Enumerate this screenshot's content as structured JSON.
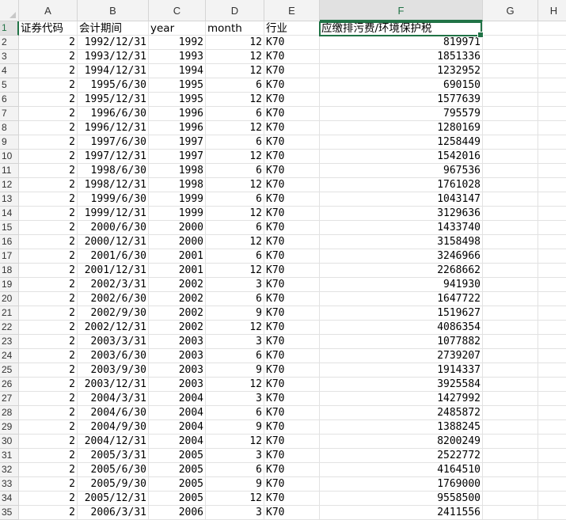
{
  "columns": [
    "A",
    "B",
    "C",
    "D",
    "E",
    "F",
    "G",
    "H"
  ],
  "selected_column": "F",
  "selected_row": "1",
  "header_row": {
    "row_label": "1",
    "cells": [
      "证券代码",
      "会计期间",
      "year",
      "month",
      "行业",
      "应缴排污费/环境保护税",
      "",
      ""
    ]
  },
  "rows": [
    {
      "n": "2",
      "a": "2",
      "b": "1992/12/31",
      "c": "1992",
      "d": "12",
      "e": "K70",
      "f": "819971"
    },
    {
      "n": "3",
      "a": "2",
      "b": "1993/12/31",
      "c": "1993",
      "d": "12",
      "e": "K70",
      "f": "1851336"
    },
    {
      "n": "4",
      "a": "2",
      "b": "1994/12/31",
      "c": "1994",
      "d": "12",
      "e": "K70",
      "f": "1232952"
    },
    {
      "n": "5",
      "a": "2",
      "b": "1995/6/30",
      "c": "1995",
      "d": "6",
      "e": "K70",
      "f": "690150"
    },
    {
      "n": "6",
      "a": "2",
      "b": "1995/12/31",
      "c": "1995",
      "d": "12",
      "e": "K70",
      "f": "1577639"
    },
    {
      "n": "7",
      "a": "2",
      "b": "1996/6/30",
      "c": "1996",
      "d": "6",
      "e": "K70",
      "f": "795579"
    },
    {
      "n": "8",
      "a": "2",
      "b": "1996/12/31",
      "c": "1996",
      "d": "12",
      "e": "K70",
      "f": "1280169"
    },
    {
      "n": "9",
      "a": "2",
      "b": "1997/6/30",
      "c": "1997",
      "d": "6",
      "e": "K70",
      "f": "1258449"
    },
    {
      "n": "10",
      "a": "2",
      "b": "1997/12/31",
      "c": "1997",
      "d": "12",
      "e": "K70",
      "f": "1542016"
    },
    {
      "n": "11",
      "a": "2",
      "b": "1998/6/30",
      "c": "1998",
      "d": "6",
      "e": "K70",
      "f": "967536"
    },
    {
      "n": "12",
      "a": "2",
      "b": "1998/12/31",
      "c": "1998",
      "d": "12",
      "e": "K70",
      "f": "1761028"
    },
    {
      "n": "13",
      "a": "2",
      "b": "1999/6/30",
      "c": "1999",
      "d": "6",
      "e": "K70",
      "f": "1043147"
    },
    {
      "n": "14",
      "a": "2",
      "b": "1999/12/31",
      "c": "1999",
      "d": "12",
      "e": "K70",
      "f": "3129636"
    },
    {
      "n": "15",
      "a": "2",
      "b": "2000/6/30",
      "c": "2000",
      "d": "6",
      "e": "K70",
      "f": "1433740"
    },
    {
      "n": "16",
      "a": "2",
      "b": "2000/12/31",
      "c": "2000",
      "d": "12",
      "e": "K70",
      "f": "3158498"
    },
    {
      "n": "17",
      "a": "2",
      "b": "2001/6/30",
      "c": "2001",
      "d": "6",
      "e": "K70",
      "f": "3246966"
    },
    {
      "n": "18",
      "a": "2",
      "b": "2001/12/31",
      "c": "2001",
      "d": "12",
      "e": "K70",
      "f": "2268662"
    },
    {
      "n": "19",
      "a": "2",
      "b": "2002/3/31",
      "c": "2002",
      "d": "3",
      "e": "K70",
      "f": "941930"
    },
    {
      "n": "20",
      "a": "2",
      "b": "2002/6/30",
      "c": "2002",
      "d": "6",
      "e": "K70",
      "f": "1647722"
    },
    {
      "n": "21",
      "a": "2",
      "b": "2002/9/30",
      "c": "2002",
      "d": "9",
      "e": "K70",
      "f": "1519627"
    },
    {
      "n": "22",
      "a": "2",
      "b": "2002/12/31",
      "c": "2002",
      "d": "12",
      "e": "K70",
      "f": "4086354"
    },
    {
      "n": "23",
      "a": "2",
      "b": "2003/3/31",
      "c": "2003",
      "d": "3",
      "e": "K70",
      "f": "1077882"
    },
    {
      "n": "24",
      "a": "2",
      "b": "2003/6/30",
      "c": "2003",
      "d": "6",
      "e": "K70",
      "f": "2739207"
    },
    {
      "n": "25",
      "a": "2",
      "b": "2003/9/30",
      "c": "2003",
      "d": "9",
      "e": "K70",
      "f": "1914337"
    },
    {
      "n": "26",
      "a": "2",
      "b": "2003/12/31",
      "c": "2003",
      "d": "12",
      "e": "K70",
      "f": "3925584"
    },
    {
      "n": "27",
      "a": "2",
      "b": "2004/3/31",
      "c": "2004",
      "d": "3",
      "e": "K70",
      "f": "1427992"
    },
    {
      "n": "28",
      "a": "2",
      "b": "2004/6/30",
      "c": "2004",
      "d": "6",
      "e": "K70",
      "f": "2485872"
    },
    {
      "n": "29",
      "a": "2",
      "b": "2004/9/30",
      "c": "2004",
      "d": "9",
      "e": "K70",
      "f": "1388245"
    },
    {
      "n": "30",
      "a": "2",
      "b": "2004/12/31",
      "c": "2004",
      "d": "12",
      "e": "K70",
      "f": "8200249"
    },
    {
      "n": "31",
      "a": "2",
      "b": "2005/3/31",
      "c": "2005",
      "d": "3",
      "e": "K70",
      "f": "2522772"
    },
    {
      "n": "32",
      "a": "2",
      "b": "2005/6/30",
      "c": "2005",
      "d": "6",
      "e": "K70",
      "f": "4164510"
    },
    {
      "n": "33",
      "a": "2",
      "b": "2005/9/30",
      "c": "2005",
      "d": "9",
      "e": "K70",
      "f": "1769000"
    },
    {
      "n": "34",
      "a": "2",
      "b": "2005/12/31",
      "c": "2005",
      "d": "12",
      "e": "K70",
      "f": "9558500"
    },
    {
      "n": "35",
      "a": "2",
      "b": "2006/3/31",
      "c": "2006",
      "d": "3",
      "e": "K70",
      "f": "2411556"
    }
  ],
  "colors": {
    "accent": "#217346",
    "header_bg": "#f3f3f3",
    "grid": "#e2e2e2"
  }
}
